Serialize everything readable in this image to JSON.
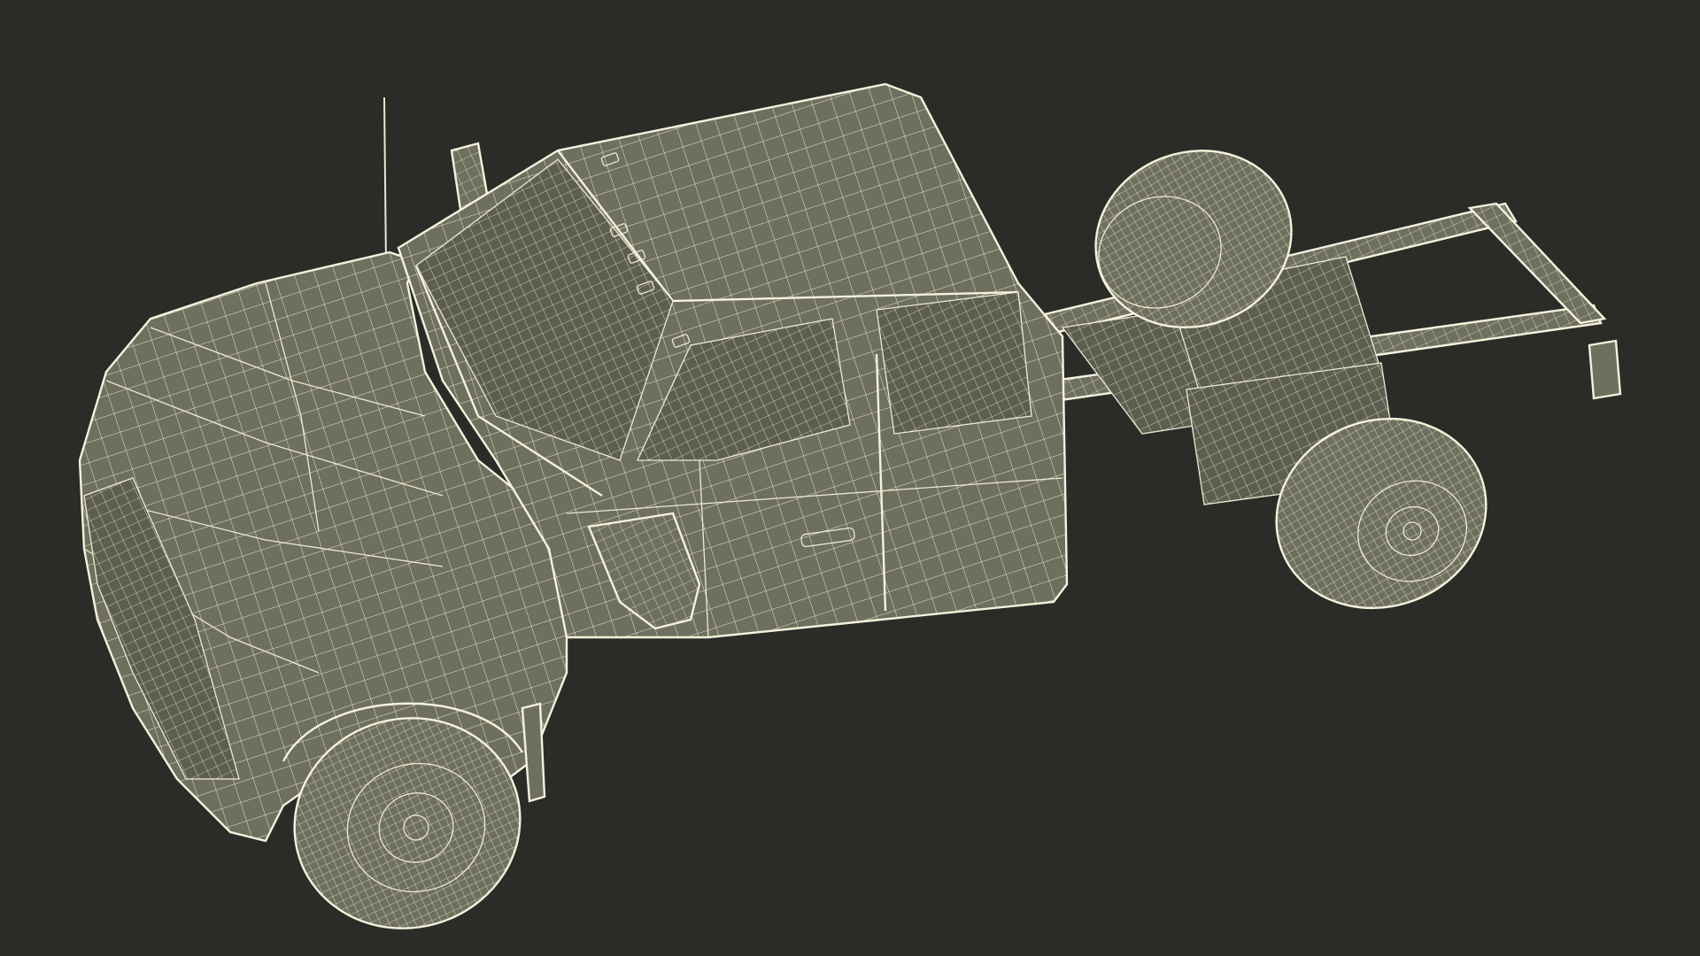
{
  "scene": {
    "subject": "wireframe-pickup-truck-chassis-cab",
    "colors": {
      "background": "#2b2b28",
      "surface": "#6f6f5f",
      "wireframe": "#ecebd3"
    }
  }
}
